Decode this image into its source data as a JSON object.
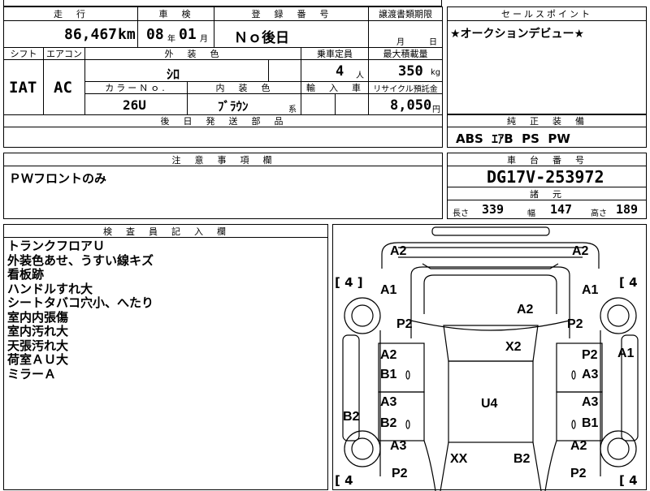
{
  "header": {
    "mileage_label": "走　行",
    "mileage_value": "86,467",
    "mileage_unit": "km",
    "inspection_label": "車　検",
    "inspection_year": "08",
    "inspection_year_unit": "年",
    "inspection_month": "01",
    "inspection_month_unit": "月",
    "registration_label": "登　録　番　号",
    "registration_value": "Ｎｏ後日",
    "transfer_label": "譲渡書類期限",
    "transfer_month_unit": "月",
    "transfer_day_unit": "日",
    "sales_point_label": "セールスポイント",
    "sales_point_text": "★オークションデビュー★"
  },
  "specs": {
    "shift_label": "シフト",
    "shift_value": "IAT",
    "aircon_label": "エアコン",
    "aircon_value": "AC",
    "exterior_color_label": "外　装　色",
    "exterior_color_value": "ｼﾛ",
    "capacity_label": "乗車定員",
    "capacity_value": "4",
    "capacity_unit": "人",
    "max_load_label": "最大積載量",
    "max_load_value": "350",
    "max_load_unit": "kg",
    "color_no_label": "カラーＮｏ.",
    "color_no_value": "26U",
    "interior_color_label": "内　装　色",
    "interior_color_value": "ﾌﾞﾗｳﾝ",
    "interior_color_suffix": "系",
    "import_label": "輸　入　車",
    "recycle_label": "リサイクル預託金",
    "recycle_value": "8,050",
    "recycle_unit": "円",
    "later_parts_label": "後　日　発　送　部　品"
  },
  "equipment": {
    "label": "純　正　装　備",
    "value": "ABS  ｴｱB  PS  PW"
  },
  "notes": {
    "label": "注　意　事　項　欄",
    "text": "ＰＷフロントのみ"
  },
  "chassis": {
    "label": "車　台　番　号",
    "value": "DG17V-253972",
    "dims_label": "諸　元",
    "length_label": "長さ",
    "length_value": "339",
    "width_label": "幅",
    "width_value": "147",
    "height_label": "高さ",
    "height_value": "189"
  },
  "inspector": {
    "label": "検　査　員　記　入　欄",
    "lines": [
      "トランクフロアＵ",
      "外装色あせ、うすい線キズ",
      "看板跡",
      "ハンドルすれ大",
      "シートタバコ穴小、へたり",
      "室内内張傷",
      "室内汚れ大",
      "天張汚れ大",
      "荷室ＡＵ大",
      "ミラーＡ"
    ]
  },
  "damage_map": {
    "tire_left_top": "4",
    "tire_right_top": "4",
    "tire_left_bottom": "4",
    "tire_right_bottom": "4",
    "marks": {
      "top_left": "A2",
      "top_right": "A2",
      "front_left": "A1",
      "front_right": "A1",
      "hood": "A2",
      "left_fender": "P2",
      "right_fender": "P2",
      "windshield": "X2",
      "right_side": "A1",
      "left_door1_a": "A2",
      "left_door1_b": "B1",
      "right_door1_a": "P2",
      "right_door1_b": "A3",
      "roof": "U4",
      "left_door2_a": "A3",
      "left_door2_b": "B2",
      "right_door2_a": "A3",
      "right_door2_b": "B1",
      "left_sill": "B2",
      "left_rear_a": "A3",
      "left_rear_b": "P2",
      "right_rear_a": "A2",
      "right_rear_b": "P2",
      "rear_glass": "XX",
      "rear_b": "B2"
    }
  }
}
